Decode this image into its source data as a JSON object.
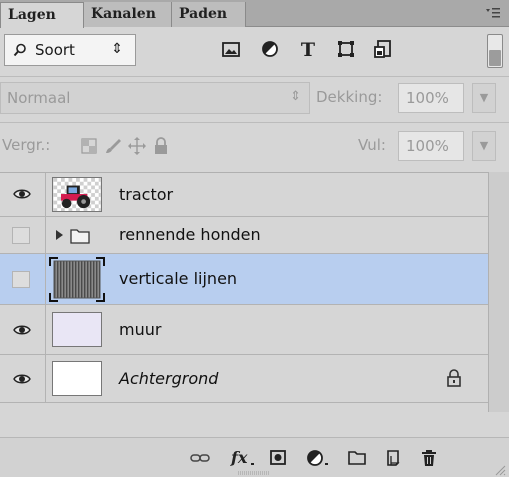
{
  "tabs": [
    {
      "label": "Lagen",
      "active": true
    },
    {
      "label": "Kanalen",
      "active": false
    },
    {
      "label": "Paden",
      "active": false
    }
  ],
  "filter": {
    "label": "Soort",
    "icons": [
      "image-filter-icon",
      "adjustment-filter-icon",
      "type-filter-icon",
      "shape-filter-icon",
      "smartobject-filter-icon"
    ]
  },
  "blend": {
    "mode": "Normaal"
  },
  "opacity": {
    "label": "Dekking:",
    "value": "100%"
  },
  "fill": {
    "label": "Vul:",
    "value": "100%"
  },
  "lock": {
    "label": "Vergr.:",
    "icons": [
      "lock-transparency-icon",
      "lock-image-icon",
      "lock-position-icon",
      "lock-all-icon"
    ]
  },
  "layers": [
    {
      "name": "tractor",
      "visible": true,
      "type": "tractor"
    },
    {
      "name": "rennende honden",
      "visible": false,
      "type": "group"
    },
    {
      "name": "verticale lijnen",
      "visible": false,
      "type": "lines",
      "selected": true
    },
    {
      "name": "muur",
      "visible": true,
      "type": "wall"
    },
    {
      "name": "Achtergrond",
      "visible": true,
      "type": "background",
      "locked": true
    }
  ],
  "bottom_icons": [
    "link-layers-icon",
    "fx-icon",
    "add-mask-icon",
    "adjustment-layer-icon",
    "new-group-icon",
    "new-layer-icon",
    "delete-layer-icon"
  ],
  "colors": {
    "selection": "#b8ceef",
    "panel": "#d6d6d6",
    "tabbar": "#a9a9a9"
  }
}
